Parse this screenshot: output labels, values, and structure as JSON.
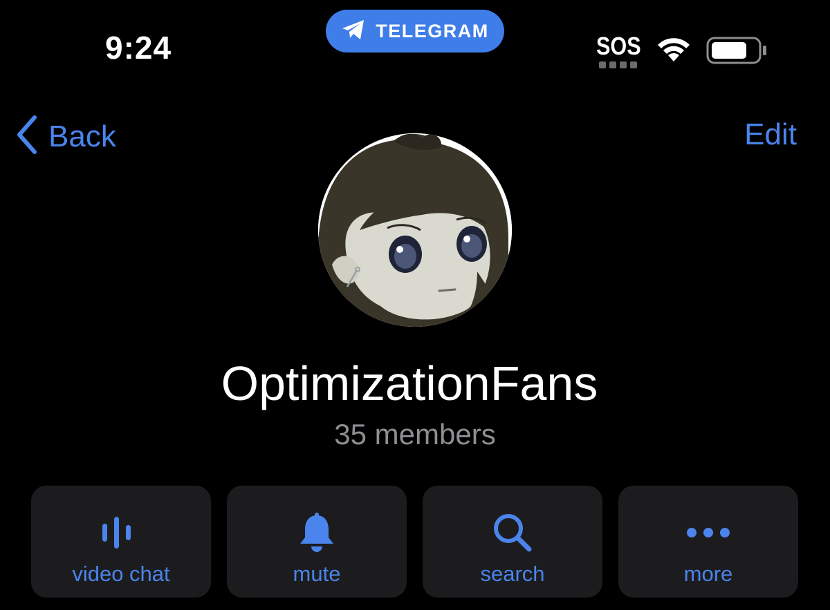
{
  "status_bar": {
    "time": "9:24",
    "app_pill_label": "TELEGRAM",
    "carrier_text": "SOS",
    "icons": [
      "telegram-plane-icon",
      "wifi-icon",
      "battery-icon"
    ]
  },
  "nav": {
    "back_label": "Back",
    "edit_label": "Edit"
  },
  "profile": {
    "group_name": "OptimizationFans",
    "members_text": "35 members"
  },
  "actions": [
    {
      "label": "video chat",
      "icon": "voice-chat-icon"
    },
    {
      "label": "mute",
      "icon": "bell-icon"
    },
    {
      "label": "search",
      "icon": "search-icon"
    },
    {
      "label": "more",
      "icon": "more-dots-icon"
    }
  ],
  "colors": {
    "accent": "#4a84ec",
    "pill": "#3f7de8",
    "background": "#000000",
    "button_bg": "#1c1c1e",
    "secondary_text": "#8e8e93"
  }
}
